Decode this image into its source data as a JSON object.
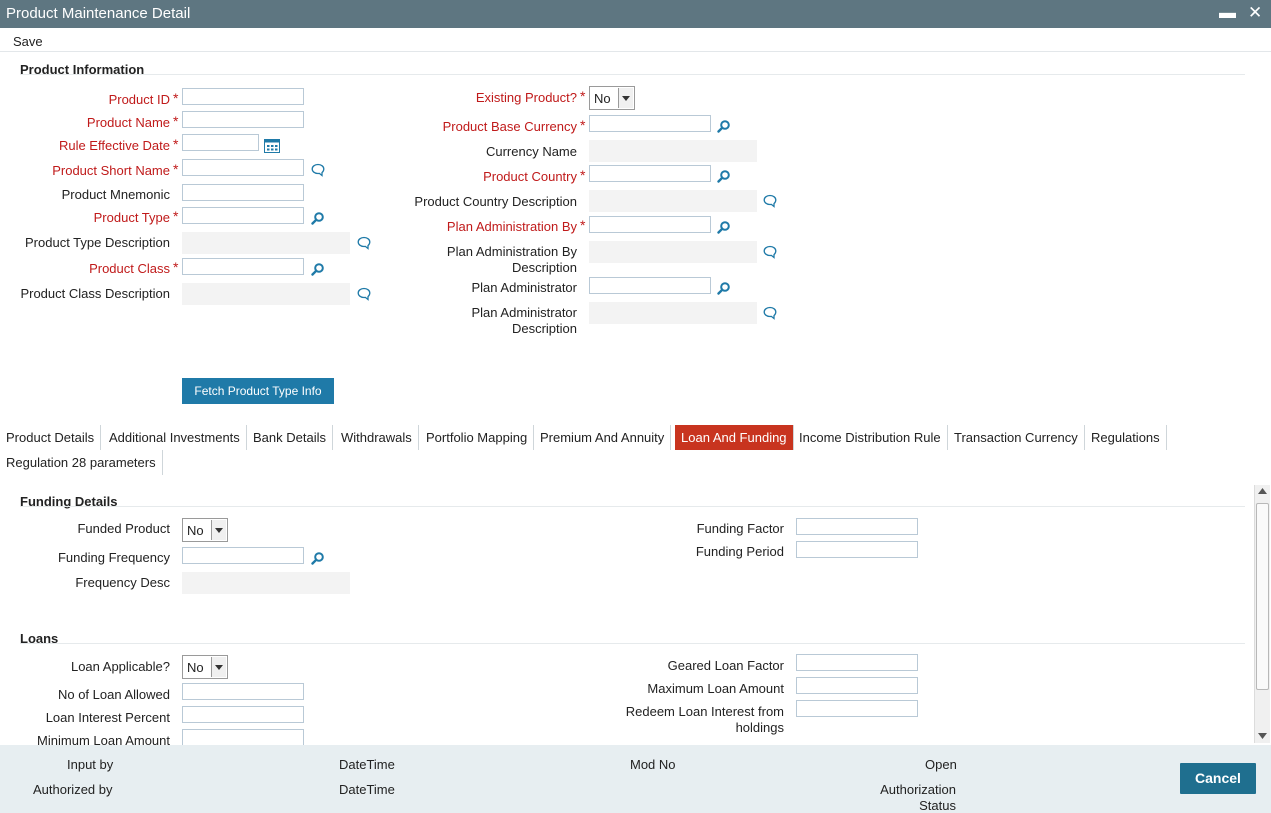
{
  "window": {
    "title": "Product Maintenance Detail",
    "minimize_label": "▬",
    "close_label": "✕"
  },
  "toolbar": {
    "save_label": "Save"
  },
  "product_information": {
    "title": "Product Information",
    "product_id": {
      "label": "Product ID",
      "value": ""
    },
    "product_name": {
      "label": "Product Name",
      "value": ""
    },
    "rule_effective_date": {
      "label": "Rule Effective Date",
      "value": ""
    },
    "product_short_name": {
      "label": "Product Short Name",
      "value": ""
    },
    "product_mnemonic": {
      "label": "Product Mnemonic",
      "value": ""
    },
    "product_type": {
      "label": "Product Type",
      "value": ""
    },
    "product_type_description": {
      "label": "Product Type Description",
      "value": ""
    },
    "product_class": {
      "label": "Product Class",
      "value": ""
    },
    "product_class_description": {
      "label": "Product Class Description",
      "value": ""
    },
    "existing_product": {
      "label": "Existing Product?",
      "value": "No"
    },
    "product_base_currency": {
      "label": "Product Base Currency",
      "value": ""
    },
    "currency_name": {
      "label": "Currency Name",
      "value": ""
    },
    "product_country": {
      "label": "Product Country",
      "value": ""
    },
    "product_country_description": {
      "label": "Product Country Description",
      "value": ""
    },
    "plan_administration_by": {
      "label": "Plan Administration By",
      "value": ""
    },
    "plan_administration_by_description": {
      "label_line1": "Plan Administration By",
      "label_line2": "Description",
      "value": ""
    },
    "plan_administrator": {
      "label": "Plan Administrator",
      "value": ""
    },
    "plan_administrator_description": {
      "label_line1": "Plan Administrator",
      "label_line2": "Description",
      "value": ""
    },
    "required_mark": "*",
    "fetch_button": "Fetch Product Type Info"
  },
  "tabs": [
    {
      "label": "Product Details",
      "active": false
    },
    {
      "label": "Additional Investments",
      "active": false
    },
    {
      "label": "Bank Details",
      "active": false
    },
    {
      "label": "Withdrawals",
      "active": false
    },
    {
      "label": "Portfolio Mapping",
      "active": false
    },
    {
      "label": "Premium And Annuity",
      "active": false
    },
    {
      "label": "Loan And Funding",
      "active": true
    },
    {
      "label": "Income Distribution Rule",
      "active": false
    },
    {
      "label": "Transaction Currency",
      "active": false
    },
    {
      "label": "Regulations",
      "active": false
    },
    {
      "label": "Regulation 28 parameters",
      "active": false
    }
  ],
  "funding_details": {
    "title": "Funding Details",
    "funded_product": {
      "label": "Funded Product",
      "value": "No"
    },
    "funding_frequency": {
      "label": "Funding Frequency",
      "value": ""
    },
    "frequency_desc": {
      "label": "Frequency Desc",
      "value": ""
    },
    "funding_factor": {
      "label": "Funding Factor",
      "value": ""
    },
    "funding_period": {
      "label": "Funding Period",
      "value": ""
    }
  },
  "loans": {
    "title": "Loans",
    "loan_applicable": {
      "label": "Loan Applicable?",
      "value": "No"
    },
    "no_of_loan_allowed": {
      "label": "No of Loan Allowed",
      "value": ""
    },
    "loan_interest_percent": {
      "label": "Loan Interest Percent",
      "value": ""
    },
    "minimum_loan_amount": {
      "label": "Minimum Loan Amount",
      "value": ""
    },
    "geared_loan_factor": {
      "label": "Geared Loan Factor",
      "value": ""
    },
    "maximum_loan_amount": {
      "label": "Maximum Loan Amount",
      "value": ""
    },
    "redeem_loan_interest": {
      "label_line1": "Redeem Loan Interest from",
      "label_line2": "holdings",
      "value": ""
    }
  },
  "footer": {
    "input_by": "Input by",
    "authorized_by": "Authorized by",
    "datetime_1": "DateTime",
    "datetime_2": "DateTime",
    "mod_no": "Mod No",
    "open": "Open",
    "authorization_status_line1": "Authorization",
    "authorization_status_line2": "Status",
    "cancel_label": "Cancel"
  },
  "colors": {
    "titlebar": "#5e7681",
    "required_label": "#c01a1a",
    "active_tab": "#c8341f",
    "primary_button": "#1f7aa8",
    "cancel_button": "#1f6f8f",
    "footer_bg": "#e7eef1"
  }
}
